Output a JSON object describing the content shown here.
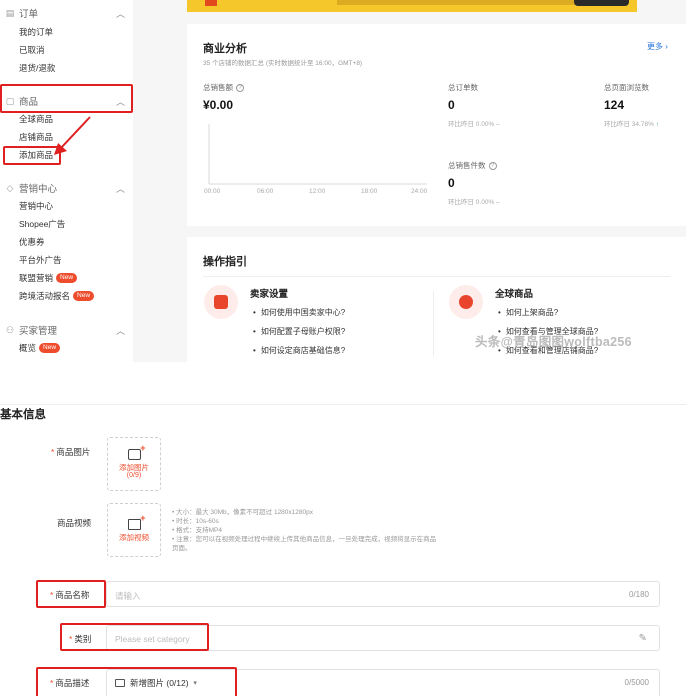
{
  "sidebar": {
    "orders": {
      "title": "订单",
      "items": [
        "我的订单",
        "已取消",
        "退货/退款"
      ]
    },
    "products": {
      "title": "商品",
      "items": [
        "全球商品",
        "店铺商品",
        "添加商品"
      ]
    },
    "marketing": {
      "title": "营销中心",
      "items": [
        "营销中心",
        "Shopee广告",
        "优惠券",
        "平台外广告",
        "联盟营销",
        "跨境活动报名"
      ],
      "new_badge": "New"
    },
    "seller": {
      "title": "买家管理",
      "items": [
        "概览"
      ],
      "new_badge": "New"
    }
  },
  "analysis": {
    "title": "商业分析",
    "subtitle": "35 个店铺的数据汇总 (实时数据统计至 16:00，GMT+8)",
    "more": "更多",
    "sales_label": "总销售额",
    "sales_value": "¥0.00",
    "orders_label": "总订单数",
    "orders_value": "0",
    "orders_cmp": "环比昨日 0.00%",
    "views_label": "总页面浏览数",
    "views_value": "124",
    "views_cmp": "环比昨日 34.78%",
    "sold_label": "总销售件数",
    "sold_value": "0",
    "sold_cmp": "环比昨日 0.00%",
    "axis": [
      "00:00",
      "06:00",
      "12:00",
      "18:00",
      "24:00"
    ]
  },
  "guide": {
    "title": "操作指引",
    "seller_title": "卖家设置",
    "seller_items": [
      "如何使用中国卖家中心?",
      "如何配置子母账户权限?",
      "如何设定商店基础信息?"
    ],
    "global_title": "全球商品",
    "global_items": [
      "如何上架商品?",
      "如何查看与管理全球商品?",
      "如何查看和管理店铺商品?"
    ]
  },
  "watermark": "头条@青岛图图wolftba256",
  "form": {
    "title": "基本信息",
    "image_label": "商品图片",
    "image_upload": "添加图片",
    "image_count": "(0/9)",
    "video_label": "商品视频",
    "video_upload": "添加视频",
    "video_notes": [
      "• 大小：最大 30Mb，像素不可超过 1280x1280px",
      "• 时长：10s-60s",
      "• 格式：支持MP4",
      "• 注意：您可以在视频处理过程中继续上传其他商品信息，一旦处理完成，视频将显示在商品",
      "   页面。"
    ],
    "name_label": "商品名称",
    "name_placeholder": "请输入",
    "name_count": "0/180",
    "category_label": "类别",
    "category_placeholder": "Please set category",
    "desc_label": "商品描述",
    "desc_add_image": "新增图片 (0/12)",
    "desc_count": "0/5000"
  },
  "colors": {
    "accent": "#ee4d2d",
    "highlight": "#e02020",
    "link": "#2673dd",
    "banner": "#f6c72a"
  }
}
